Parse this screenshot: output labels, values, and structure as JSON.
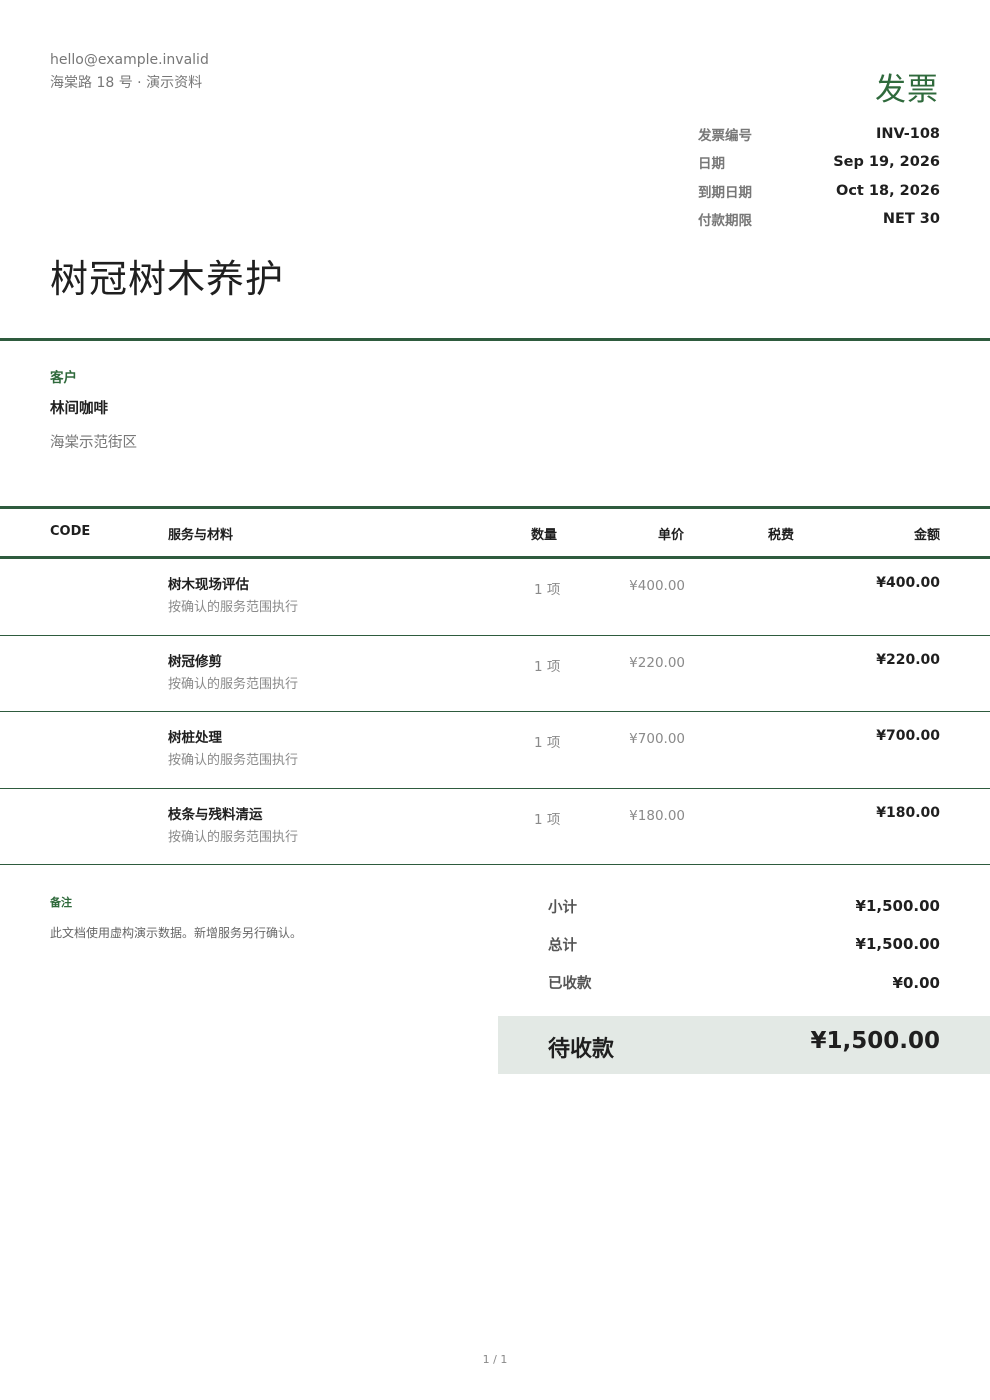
{
  "sender": {
    "email": "hello@example.invalid",
    "address": "海棠路 18 号 · 演示资料"
  },
  "document_title": "发票",
  "meta": [
    {
      "label": "发票编号",
      "value": "INV-108"
    },
    {
      "label": "日期",
      "value": "Sep 19, 2026"
    },
    {
      "label": "到期日期",
      "value": "Oct 18, 2026"
    },
    {
      "label": "付款期限",
      "value": "NET 30"
    }
  ],
  "company_name": "树冠树木养护",
  "client": {
    "label": "客户",
    "name": "林间咖啡",
    "address": "海棠示范街区"
  },
  "table": {
    "headers": {
      "code": "CODE",
      "description": "服务与材料",
      "quantity": "数量",
      "unit_price": "单价",
      "tax": "税费",
      "amount": "金额"
    },
    "rows": [
      {
        "name": "树木现场评估",
        "desc": "按确认的服务范围执行",
        "qty": "1 项",
        "price": "¥400.00",
        "amount": "¥400.00"
      },
      {
        "name": "树冠修剪",
        "desc": "按确认的服务范围执行",
        "qty": "1 项",
        "price": "¥220.00",
        "amount": "¥220.00"
      },
      {
        "name": "树桩处理",
        "desc": "按确认的服务范围执行",
        "qty": "1 项",
        "price": "¥700.00",
        "amount": "¥700.00"
      },
      {
        "name": "枝条与残料清运",
        "desc": "按确认的服务范围执行",
        "qty": "1 项",
        "price": "¥180.00",
        "amount": "¥180.00"
      }
    ]
  },
  "notes": {
    "label": "备注",
    "text": "此文档使用虚构演示数据。新增服务另行确认。"
  },
  "totals": [
    {
      "label": "小计",
      "value": "¥1,500.00"
    },
    {
      "label": "总计",
      "value": "¥1,500.00"
    },
    {
      "label": "已收款",
      "value": "¥0.00"
    }
  ],
  "balance_due": {
    "label": "待收款",
    "value": "¥1,500.00"
  },
  "page_number": "1 / 1",
  "colors": {
    "accent": "#2f6a3c",
    "rule": "#2e5b3e",
    "balance_bg": "#e3e9e5"
  }
}
